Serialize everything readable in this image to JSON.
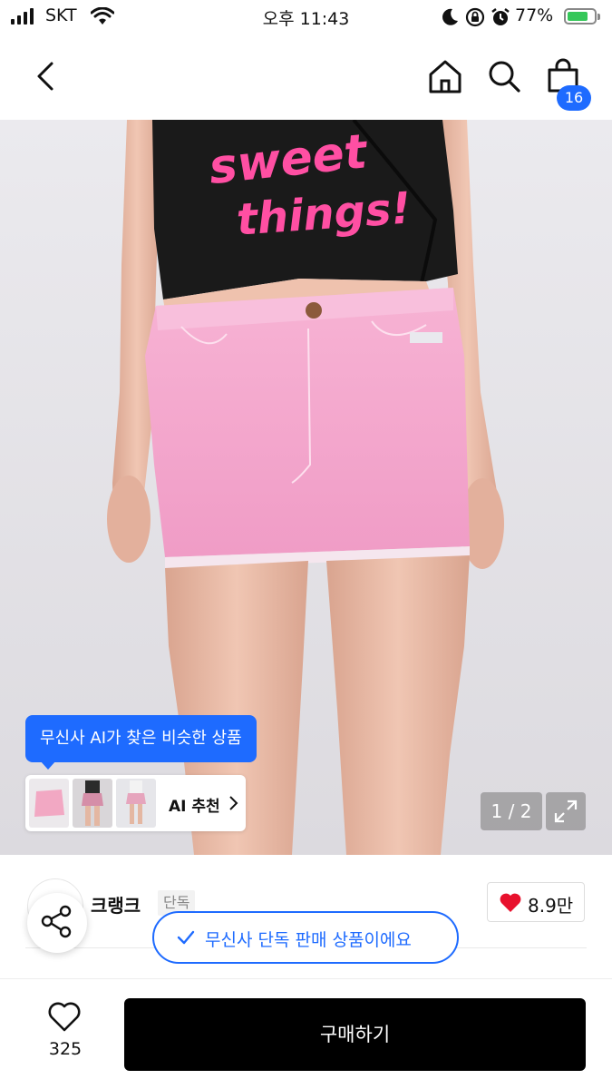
{
  "status_bar": {
    "carrier": "SKT",
    "time": "오후 11:43",
    "battery_percent": "77%",
    "icons": [
      "signal-icon",
      "wifi-icon",
      "moon-icon",
      "orientation-lock-icon",
      "alarm-icon",
      "battery-charging-icon"
    ]
  },
  "nav": {
    "icons": [
      "back-icon",
      "home-icon",
      "search-icon",
      "cart-icon"
    ],
    "cart_badge": "16",
    "accent_color": "#1e6bff"
  },
  "hero": {
    "ai_tooltip": "무신사 AI가 찾은 비슷한 상품",
    "ai_recommend_label": "AI 추천",
    "pager": "1 / 2"
  },
  "brand": {
    "name": "크랭크",
    "exclusive_tag": "단독",
    "like_count": "8.9만",
    "exclusive_notice": "무신사 단독 판매 상품이에요"
  },
  "bottom_bar": {
    "wish_count": "325",
    "buy_label": "구매하기"
  }
}
